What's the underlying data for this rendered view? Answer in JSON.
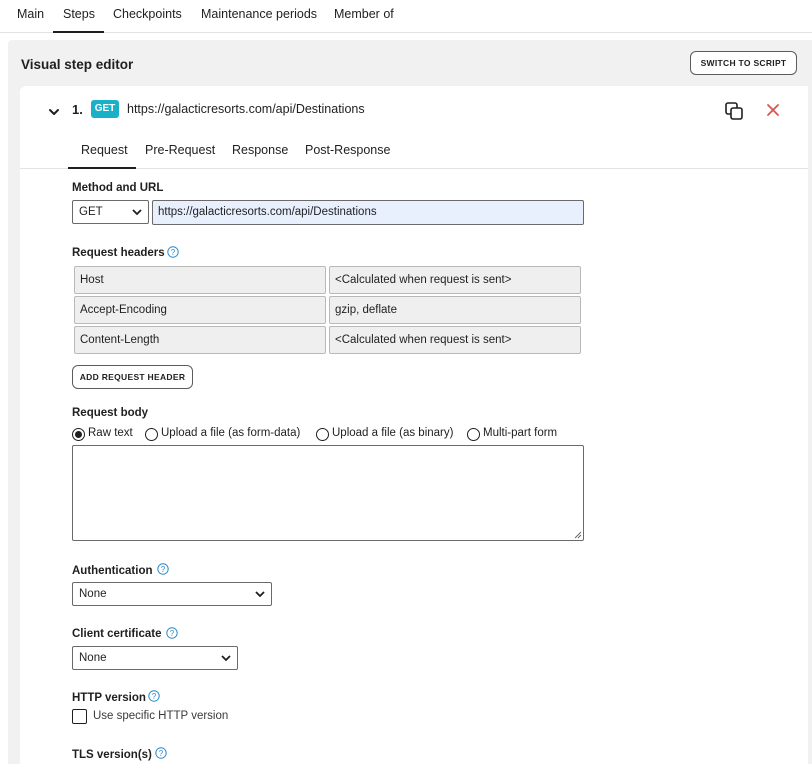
{
  "top_tabs": [
    "Main",
    "Steps",
    "Checkpoints",
    "Maintenance periods",
    "Member of"
  ],
  "editor": {
    "title": "Visual step editor",
    "switch_button": "SWITCH TO SCRIPT"
  },
  "step": {
    "number": "1.",
    "method_badge": "GET",
    "url": "https://galacticresorts.com/api/Destinations",
    "badge_color": "#1ab0c8"
  },
  "sub_tabs": [
    "Request",
    "Pre-Request",
    "Response",
    "Post-Response"
  ],
  "request": {
    "method_url_label": "Method and URL",
    "method": "GET",
    "url": "https://galacticresorts.com/api/Destinations",
    "headers_label": "Request headers",
    "headers": [
      {
        "name": "Host",
        "value": "<Calculated when request is sent>"
      },
      {
        "name": "Accept-Encoding",
        "value": "gzip, deflate"
      },
      {
        "name": "Content-Length",
        "value": "<Calculated when request is sent>"
      }
    ],
    "add_header_button": "ADD REQUEST HEADER",
    "body_label": "Request body",
    "body_options": [
      "Raw text",
      "Upload a file (as form-data)",
      "Upload a file (as binary)",
      "Multi-part form"
    ],
    "body_selected": "Raw text",
    "body_value": "",
    "auth_label": "Authentication",
    "auth_value": "None",
    "cert_label": "Client certificate",
    "cert_value": "None",
    "http_label": "HTTP version",
    "http_checkbox": "Use specific HTTP version",
    "tls_label": "TLS version(s)"
  }
}
